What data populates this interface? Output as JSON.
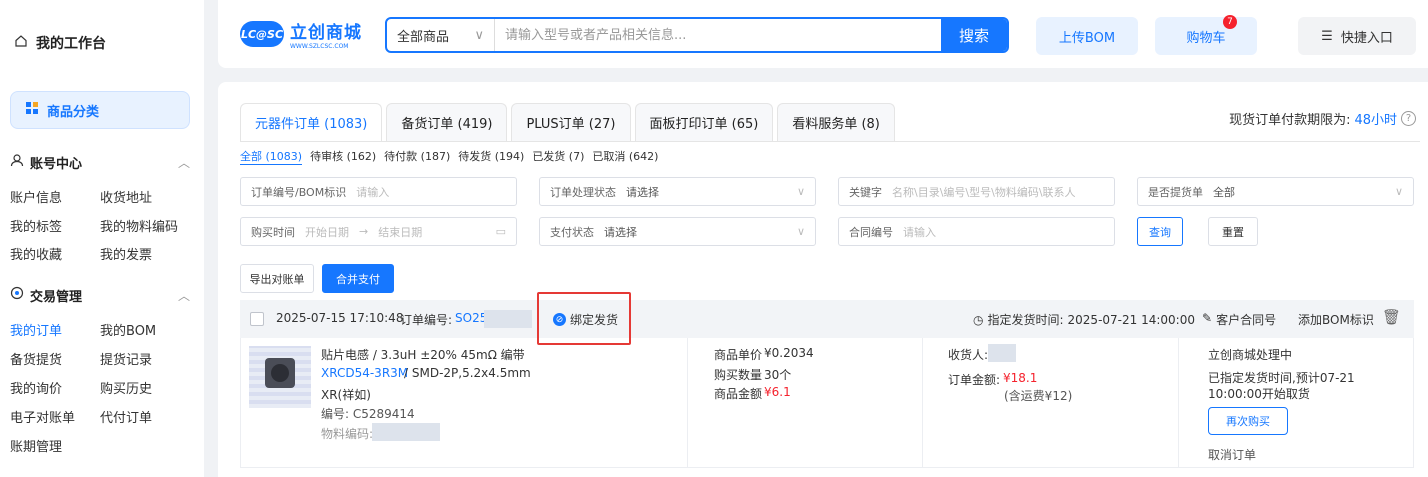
{
  "sidebar": {
    "workspace_title": "我的工作台",
    "category_button": "商品分类",
    "account_center": {
      "title": "账号中心",
      "links": [
        "账户信息",
        "收货地址",
        "我的标签",
        "我的物料编码",
        "我的收藏",
        "我的发票"
      ]
    },
    "trade_mgmt": {
      "title": "交易管理",
      "links": [
        "我的订单",
        "我的BOM",
        "备货提货",
        "提货记录",
        "我的询价",
        "购买历史",
        "电子对账单",
        "代付订单",
        "账期管理"
      ]
    }
  },
  "header": {
    "logo_main": "立创商城",
    "logo_badge": "LC@SC",
    "logo_sub": "WWW.SZLCSC.COM",
    "search_category": "全部商品",
    "search_placeholder": "请输入型号或者产品相关信息...",
    "search_button": "搜索",
    "upload_bom": "上传BOM",
    "cart": "购物车",
    "cart_count": "7",
    "quick_entry": "快捷入口"
  },
  "tabs": [
    {
      "label": "元器件订单 (1083)"
    },
    {
      "label": "备货订单 (419)"
    },
    {
      "label": "PLUS订单 (27)"
    },
    {
      "label": "面板打印订单 (65)"
    },
    {
      "label": "看料服务单 (8)"
    }
  ],
  "deadline": {
    "label": "现货订单付款期限为:",
    "value": "48小时"
  },
  "subtabs": [
    "全部 (1083)",
    "待审核 (162)",
    "待付款 (187)",
    "待发货 (194)",
    "已发货 (7)",
    "已取消 (642)"
  ],
  "filters": {
    "order_no": {
      "label": "订单编号/BOM标识",
      "placeholder": "请输入"
    },
    "process_status": {
      "label": "订单处理状态",
      "placeholder": "请选择"
    },
    "keyword": {
      "label": "关键字",
      "placeholder": "名称\\目录\\编号\\型号\\物料编码\\联系人"
    },
    "pickup": {
      "label": "是否提货单",
      "value": "全部"
    },
    "buy_time": {
      "label": "购买时间",
      "start": "开始日期",
      "arrow": "→",
      "end": "结束日期"
    },
    "pay_status": {
      "label": "支付状态",
      "placeholder": "请选择"
    },
    "contract_no": {
      "label": "合同编号",
      "placeholder": "请输入"
    },
    "query_button": "查询",
    "reset_button": "重置"
  },
  "actions": {
    "export": "导出对账单",
    "merge_pay": "合并支付"
  },
  "order": {
    "datetime": "2025-07-15 17:10:48",
    "order_no_label": "订单编号:",
    "order_no": "SO25",
    "bind_ship": "绑定发货",
    "ship_time_label": "指定发货时间:",
    "ship_time": "2025-07-21 14:00:00",
    "contract": "客户合同号",
    "add_bom": "添加BOM标识",
    "product": {
      "name": "贴片电感 / 3.3uH ±20% 45mΩ 编带",
      "model": "XRCD54-3R3M",
      "package": "/ SMD-2P,5.2x4.5mm",
      "brand": "XR(祥如)",
      "code": "编号: C5289414",
      "material_label": "物料编码:"
    },
    "price": {
      "unit_label": "商品单价",
      "unit": "¥0.2034",
      "qty_label": "购买数量",
      "qty": "30个",
      "amount_label": "商品金额",
      "amount": "¥6.1"
    },
    "receiver_label": "收货人:",
    "total_label": "订单金额:",
    "total": "¥18.1",
    "freight": "(含运费¥12)",
    "status": {
      "title": "立创商城处理中",
      "note": "已指定发货时间,预计07-21 10:00:00开始取货",
      "rebuy": "再次购买",
      "cancel": "取消订单"
    }
  },
  "colors": {
    "accent": "#1677ff",
    "price_red": "#f5222d",
    "highlight_border": "#e53935"
  }
}
